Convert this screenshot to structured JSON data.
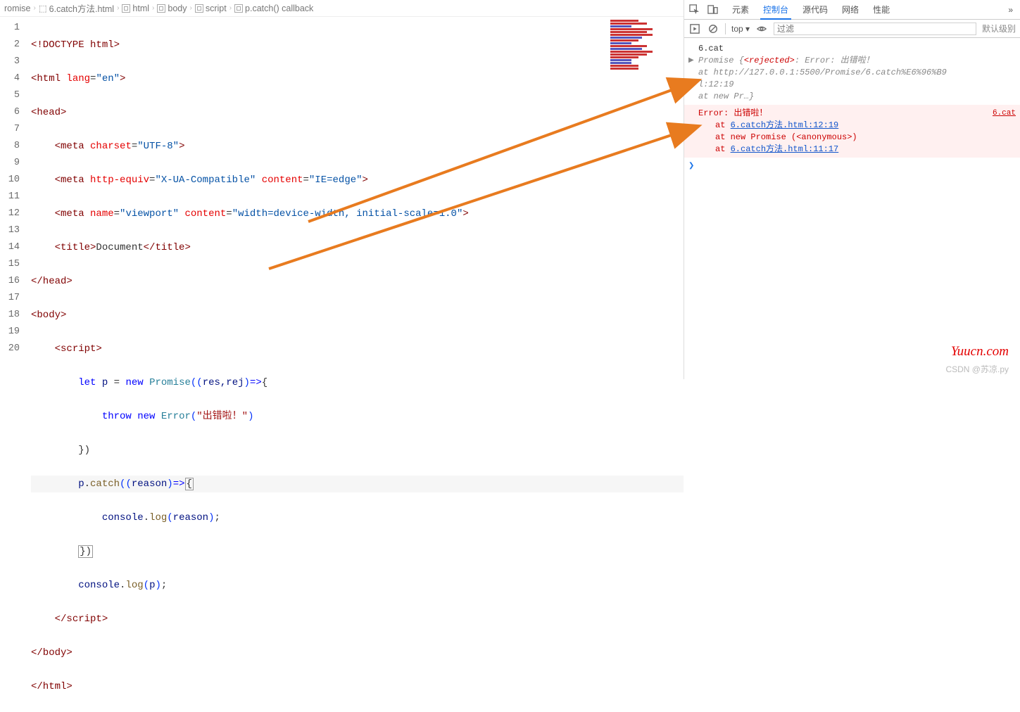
{
  "breadcrumb": {
    "items": [
      "romise",
      "6.catch方法.html",
      "html",
      "body",
      "script",
      "p.catch() callback"
    ]
  },
  "editor": {
    "line_numbers": [
      "1",
      "2",
      "3",
      "4",
      "5",
      "6",
      "7",
      "8",
      "9",
      "10",
      "11",
      "12",
      "13",
      "14",
      "15",
      "16",
      "17",
      "18",
      "19",
      "20"
    ],
    "tokens": {
      "l1_doctype": "<!DOCTYPE",
      "l1_html": " html",
      "l1_close": ">",
      "l2_open": "<html ",
      "l2_attr": "lang",
      "l2_eq": "=",
      "l2_val": "\"en\"",
      "l2_close": ">",
      "l3": "<head>",
      "l4_open": "<meta ",
      "l4_attr": "charset",
      "l4_eq": "=",
      "l4_val": "\"UTF-8\"",
      "l4_close": ">",
      "l5_open": "<meta ",
      "l5_attr1": "http-equiv",
      "l5_eq1": "=",
      "l5_val1": "\"X-UA-Compatible\"",
      "l5_sp": " ",
      "l5_attr2": "content",
      "l5_eq2": "=",
      "l5_val2": "\"IE=edge\"",
      "l5_close": ">",
      "l6_open": "<meta ",
      "l6_attr1": "name",
      "l6_eq1": "=",
      "l6_val1": "\"viewport\"",
      "l6_sp": " ",
      "l6_attr2": "content",
      "l6_eq2": "=",
      "l6_val2": "\"width=device-width, initial-scale=1.0\"",
      "l6_close": ">",
      "l7_open": "<title>",
      "l7_txt": "Document",
      "l7_close": "</title>",
      "l8": "</head>",
      "l9": "<body>",
      "l10": "<script>",
      "l11_let": "let",
      "l11_p": " p ",
      "l11_eq": "= ",
      "l11_new": "new ",
      "l11_promise": "Promise",
      "l11_par1": "((",
      "l11_args": "res,rej",
      "l11_par2": ")",
      "l11_arrow": "=>",
      "l11_brace": "{",
      "l12_throw": "throw ",
      "l12_new": "new ",
      "l12_err": "Error",
      "l12_par1": "(",
      "l12_str": "\"出错啦！\"",
      "l12_par2": ")",
      "l13": "})",
      "l14_p": "p",
      "l14_dot": ".",
      "l14_catch": "catch",
      "l14_par1": "((",
      "l14_reason": "reason",
      "l14_par2": ")",
      "l14_arrow": "=>",
      "l14_brace": "{",
      "l15_console": "console",
      "l15_dot": ".",
      "l15_log": "log",
      "l15_par1": "(",
      "l15_reason": "reason",
      "l15_par2": ")",
      "l15_semi": ";",
      "l16": "})",
      "l17_console": "console",
      "l17_dot": ".",
      "l17_log": "log",
      "l17_par1": "(",
      "l17_p": "p",
      "l17_par2": ")",
      "l17_semi": ";",
      "l18": "</script>",
      "l19": "</body>",
      "l20": "</html>"
    }
  },
  "devtools": {
    "tabs": {
      "elements": "元素",
      "console": "控制台",
      "sources": "源代码",
      "network": "网络",
      "perf": "性能"
    },
    "more": "»",
    "filter": {
      "top": "top ▾",
      "placeholder": "过滤",
      "level": "默认级别"
    },
    "source_link1": "6.cat",
    "source_link2": "6.cat",
    "promise_line1": "Promise {",
    "promise_state": "<rejected>",
    "promise_colon": ": Error: 出错啦！",
    "promise_line2": "    at http://127.0.0.1:5500/Promise/6.catch%E6%96%B9",
    "promise_line2b": "l:12:19",
    "promise_line3": "    at new Pr…",
    "promise_close": "}",
    "err_line1": "Error: 出错啦！",
    "err_at1": "at ",
    "err_link1": "6.catch方法.html:12:19",
    "err_at2": "at new Promise (<anonymous>)",
    "err_at3": "at ",
    "err_link3": "6.catch方法.html:11:17"
  },
  "watermark1": "Yuucn.com",
  "watermark2": "CSDN @苏凉.py"
}
